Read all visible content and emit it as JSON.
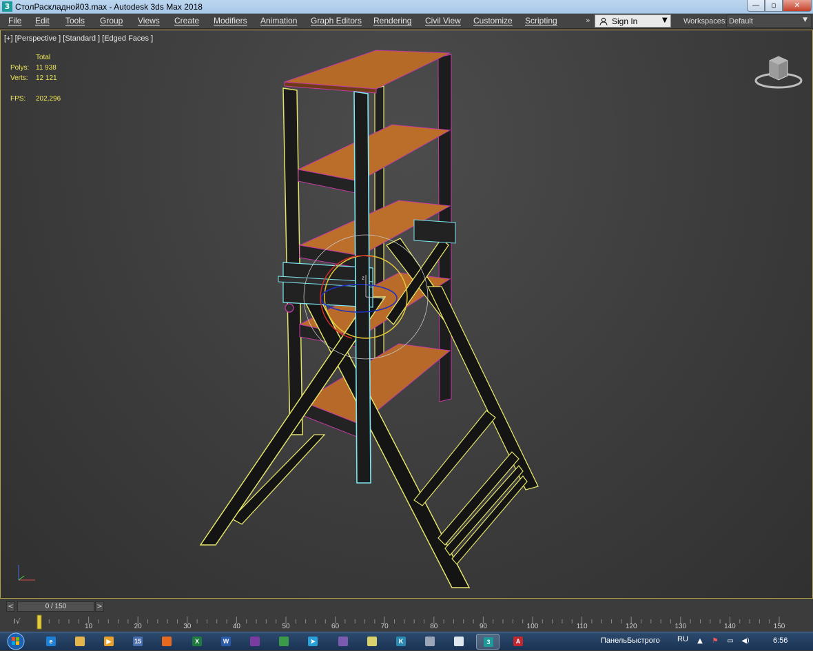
{
  "window": {
    "title": "СтолРаскладной03.max - Autodesk 3ds Max 2018",
    "minimize": "—",
    "maximize": "▫",
    "close": "✕"
  },
  "menu": {
    "items": [
      "File",
      "Edit",
      "Tools",
      "Group",
      "Views",
      "Create",
      "Modifiers",
      "Animation",
      "Graph Editors",
      "Rendering",
      "Civil View",
      "Customize",
      "Scripting"
    ],
    "more": "»",
    "sign_in": "Sign In",
    "workspaces_label": "Workspaces:",
    "workspace_value": "Default"
  },
  "viewport": {
    "label": "[+] [Perspective ] [Standard ] [Edged Faces ]",
    "stats": {
      "header": "Total",
      "polys_label": "Polys:",
      "polys_value": "11 938",
      "verts_label": "Verts:",
      "verts_value": "12 121",
      "fps_label": "FPS:",
      "fps_value": "202,296"
    },
    "gizmo_axes": {
      "z": "z",
      "x": "x"
    },
    "colors": {
      "wood": "#b56a27",
      "selection_yellow": "#e4e36a",
      "edge_magenta": "#c33aa4",
      "selected_cyan": "#7fe7f2"
    }
  },
  "timeline": {
    "prev": "<",
    "next": ">",
    "frame": "0 / 150",
    "ticks": [
      "10",
      "20",
      "30",
      "40",
      "50",
      "60",
      "70",
      "80",
      "90",
      "100",
      "110",
      "120",
      "130",
      "140",
      "150"
    ]
  },
  "taskbar": {
    "tray_label": "ПанельБыстрого",
    "lang": "RU",
    "time": "6:56",
    "apps": [
      {
        "icon": "internet-explorer-icon",
        "glyph": "e",
        "color": "#1e7fd6"
      },
      {
        "icon": "folder-icon",
        "glyph": "",
        "color": "#e3b54a"
      },
      {
        "icon": "media-player-icon",
        "glyph": "▶",
        "color": "#e9a12a"
      },
      {
        "icon": "calculator-icon",
        "glyph": "15",
        "color": "#4a6fb0"
      },
      {
        "icon": "firefox-icon",
        "glyph": "",
        "color": "#e56a1f"
      },
      {
        "icon": "excel-icon",
        "glyph": "X",
        "color": "#1f7a3e"
      },
      {
        "icon": "word-icon",
        "glyph": "W",
        "color": "#2b5aaa"
      },
      {
        "icon": "onenote-icon",
        "glyph": "",
        "color": "#7a3ca0"
      },
      {
        "icon": "chrome-icon",
        "glyph": "",
        "color": "#3b9a4a"
      },
      {
        "icon": "telegram-icon",
        "glyph": "➤",
        "color": "#2a9fd8"
      },
      {
        "icon": "viber-icon",
        "glyph": "",
        "color": "#7b5bb0"
      },
      {
        "icon": "notepad-icon",
        "glyph": "",
        "color": "#d9d26a"
      },
      {
        "icon": "kompas-icon",
        "glyph": "K",
        "color": "#2a8ab0"
      },
      {
        "icon": "calc-app-icon",
        "glyph": "",
        "color": "#9aa6b8"
      },
      {
        "icon": "document-icon",
        "glyph": "",
        "color": "#dfe6ee"
      },
      {
        "icon": "3dsmax-icon",
        "glyph": "3",
        "color": "#1d9a9a"
      },
      {
        "icon": "autocad-icon",
        "glyph": "A",
        "color": "#c2262e"
      }
    ]
  }
}
